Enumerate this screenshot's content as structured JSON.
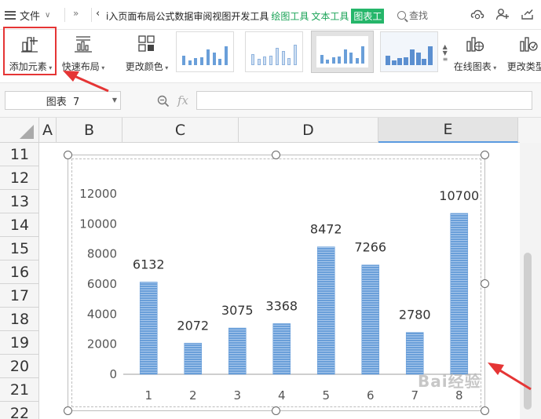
{
  "menubar": {
    "file_label": "文件",
    "tabs": [
      {
        "label": "i入页面布局公式数据审阅视图开发工具",
        "style": "normal"
      },
      {
        "label": "绘图工具",
        "style": "green"
      },
      {
        "label": "文本工具",
        "style": "green"
      },
      {
        "label": "图表工",
        "style": "active"
      }
    ],
    "search_label": "查找"
  },
  "ribbon": {
    "add_element": "添加元素",
    "quick_layout": "快速布局",
    "change_color": "更改颜色",
    "online_chart": "在线图表",
    "change_type": "更改类型"
  },
  "formula_bar": {
    "name_box": "图表  7",
    "fx": "fx",
    "formula": ""
  },
  "columns": [
    "A",
    "B",
    "C",
    "D",
    "E"
  ],
  "rows": [
    "11",
    "12",
    "13",
    "14",
    "15",
    "16",
    "17",
    "18",
    "19",
    "20",
    "21",
    "22"
  ],
  "colors": {
    "bar": "#6a9fd9",
    "bar_stripe": "#a9c8ec",
    "accent_green": "#25b66a",
    "highlight": "#e53535"
  },
  "watermark": "Bai经验",
  "chart_data": {
    "type": "bar",
    "categories": [
      "1",
      "2",
      "3",
      "4",
      "5",
      "6",
      "7",
      "8"
    ],
    "values": [
      6132,
      2072,
      3075,
      3368,
      8472,
      7266,
      2780,
      10700
    ],
    "data_labels": [
      "6132",
      "2072",
      "3075",
      "3368",
      "8472",
      "7266",
      "2780",
      "10700"
    ],
    "y_ticks": [
      "0",
      "2000",
      "4000",
      "6000",
      "8000",
      "10000",
      "12000"
    ],
    "ylim": [
      0,
      12000
    ],
    "grid": false,
    "legend": "none"
  }
}
